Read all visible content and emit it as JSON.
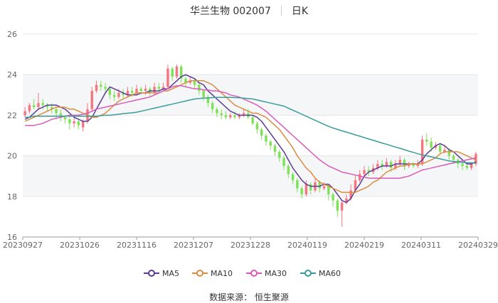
{
  "title": {
    "stock": "华兰生物 002007",
    "period": "日K"
  },
  "source_text": "数据来源：  恒生聚源",
  "chart_data": {
    "type": "candlestick",
    "ylim": [
      16,
      26
    ],
    "y_ticks": [
      16,
      18,
      20,
      22,
      24,
      26
    ],
    "x_tick_labels": [
      "20230927",
      "20231026",
      "20231116",
      "20231207",
      "20231228",
      "20240119",
      "20240219",
      "20240311",
      "20240329"
    ],
    "grid": "horizontal bands",
    "legend_position": "bottom-center",
    "colors": {
      "up": "#f4777f",
      "down": "#7fe157",
      "ma5": "#5a3b98",
      "ma10": "#dc8c40",
      "ma30": "#d95bb8",
      "ma60": "#3a9c98",
      "band": "#f5f6f8"
    },
    "candles": [
      [
        22.0,
        22.2,
        22.4,
        21.9
      ],
      [
        22.2,
        22.5,
        22.6,
        22.1
      ],
      [
        22.5,
        22.4,
        22.8,
        22.3
      ],
      [
        22.4,
        22.6,
        23.1,
        22.3
      ],
      [
        22.6,
        22.5,
        22.8,
        22.3
      ],
      [
        22.5,
        22.4,
        22.6,
        22.2
      ],
      [
        22.4,
        22.3,
        22.6,
        22.1
      ],
      [
        22.3,
        22.1,
        22.4,
        21.8
      ],
      [
        22.1,
        21.9,
        22.3,
        21.7
      ],
      [
        21.9,
        21.8,
        22.0,
        21.6
      ],
      [
        21.8,
        21.6,
        21.9,
        21.3
      ],
      [
        21.6,
        21.7,
        22.0,
        21.4
      ],
      [
        21.7,
        21.5,
        21.8,
        21.3
      ],
      [
        21.4,
        21.7,
        21.8,
        21.2
      ],
      [
        21.7,
        22.3,
        22.6,
        21.6
      ],
      [
        22.3,
        23.2,
        23.4,
        22.2
      ],
      [
        23.2,
        23.5,
        23.7,
        23.1
      ],
      [
        23.5,
        23.4,
        23.7,
        23.2
      ],
      [
        23.4,
        23.3,
        23.6,
        23.1
      ],
      [
        23.3,
        23.0,
        23.4,
        22.8
      ],
      [
        23.0,
        22.9,
        23.2,
        22.7
      ],
      [
        22.9,
        23.1,
        23.3,
        22.8
      ],
      [
        23.1,
        23.0,
        23.3,
        22.8
      ],
      [
        23.0,
        23.2,
        23.4,
        22.9
      ],
      [
        23.2,
        23.1,
        23.4,
        22.9
      ],
      [
        23.1,
        23.3,
        23.5,
        23.0
      ],
      [
        23.3,
        23.2,
        23.4,
        23.0
      ],
      [
        23.2,
        23.3,
        23.5,
        23.0
      ],
      [
        23.3,
        23.1,
        23.4,
        22.9
      ],
      [
        23.1,
        23.4,
        23.6,
        23.0
      ],
      [
        23.4,
        23.3,
        23.6,
        23.1
      ],
      [
        23.3,
        23.4,
        23.6,
        23.2
      ],
      [
        23.4,
        24.3,
        24.5,
        23.3
      ],
      [
        24.3,
        23.9,
        24.4,
        23.7
      ],
      [
        23.9,
        24.4,
        24.5,
        23.8
      ],
      [
        24.4,
        23.8,
        24.5,
        23.6
      ],
      [
        23.8,
        23.6,
        23.9,
        23.4
      ],
      [
        23.6,
        23.7,
        23.9,
        23.5
      ],
      [
        23.7,
        23.5,
        23.8,
        23.3
      ],
      [
        23.5,
        23.2,
        23.6,
        23.0
      ],
      [
        23.2,
        22.9,
        23.3,
        22.7
      ],
      [
        22.9,
        22.6,
        23.0,
        22.4
      ],
      [
        22.6,
        22.3,
        22.7,
        22.1
      ],
      [
        22.3,
        22.1,
        22.4,
        21.9
      ],
      [
        22.1,
        22.0,
        22.3,
        21.8
      ],
      [
        22.0,
        21.9,
        22.2,
        21.8
      ],
      [
        21.9,
        22.0,
        22.1,
        21.8
      ],
      [
        22.0,
        21.9,
        22.2,
        21.8
      ],
      [
        21.9,
        22.0,
        22.1,
        21.8
      ],
      [
        22.0,
        22.1,
        22.3,
        21.9
      ],
      [
        22.1,
        21.9,
        22.3,
        21.8
      ],
      [
        21.9,
        21.6,
        22.0,
        21.5
      ],
      [
        21.6,
        21.3,
        21.7,
        21.1
      ],
      [
        21.3,
        21.0,
        21.4,
        20.8
      ],
      [
        21.0,
        20.7,
        21.1,
        20.5
      ],
      [
        20.7,
        20.5,
        20.8,
        20.3
      ],
      [
        20.5,
        20.2,
        20.6,
        20.0
      ],
      [
        20.2,
        19.9,
        20.3,
        19.7
      ],
      [
        19.9,
        19.5,
        20.0,
        19.3
      ],
      [
        19.5,
        19.1,
        19.6,
        18.9
      ],
      [
        19.1,
        18.8,
        19.2,
        18.6
      ],
      [
        18.8,
        18.4,
        18.9,
        18.2
      ],
      [
        18.4,
        18.1,
        18.5,
        17.9
      ],
      [
        18.1,
        18.6,
        18.8,
        18.0
      ],
      [
        18.6,
        18.3,
        18.7,
        18.1
      ],
      [
        18.3,
        18.7,
        18.9,
        18.2
      ],
      [
        18.7,
        18.4,
        18.8,
        18.2
      ],
      [
        18.4,
        18.5,
        18.7,
        18.3
      ],
      [
        18.5,
        18.1,
        18.6,
        17.8
      ],
      [
        18.1,
        17.8,
        18.2,
        17.5
      ],
      [
        17.8,
        17.3,
        17.9,
        17.0
      ],
      [
        17.3,
        17.7,
        17.8,
        16.5
      ],
      [
        17.7,
        17.9,
        18.1,
        17.6
      ],
      [
        17.9,
        18.3,
        18.6,
        17.8
      ],
      [
        18.3,
        18.8,
        19.0,
        18.2
      ],
      [
        18.8,
        19.1,
        19.3,
        18.7
      ],
      [
        19.1,
        19.3,
        19.5,
        19.0
      ],
      [
        19.3,
        19.2,
        19.5,
        19.0
      ],
      [
        19.2,
        19.4,
        19.6,
        19.1
      ],
      [
        19.4,
        19.6,
        19.8,
        19.3
      ],
      [
        19.6,
        19.5,
        19.8,
        19.3
      ],
      [
        19.5,
        19.7,
        19.9,
        19.4
      ],
      [
        19.7,
        19.4,
        19.8,
        19.2
      ],
      [
        19.4,
        19.6,
        19.8,
        19.3
      ],
      [
        19.6,
        19.8,
        20.0,
        19.5
      ],
      [
        19.8,
        19.5,
        19.9,
        19.3
      ],
      [
        19.5,
        19.6,
        19.7,
        19.4
      ],
      [
        19.6,
        19.5,
        19.7,
        19.4
      ],
      [
        19.5,
        19.6,
        19.8,
        19.4
      ],
      [
        19.6,
        20.8,
        21.0,
        19.5
      ],
      [
        20.8,
        20.7,
        21.1,
        20.5
      ],
      [
        20.7,
        20.4,
        20.9,
        20.2
      ],
      [
        20.4,
        20.5,
        20.7,
        20.3
      ],
      [
        20.5,
        20.2,
        20.6,
        20.1
      ],
      [
        20.2,
        20.3,
        20.5,
        20.1
      ],
      [
        20.3,
        20.0,
        20.4,
        19.8
      ],
      [
        20.0,
        19.8,
        20.1,
        19.6
      ],
      [
        19.8,
        19.6,
        19.9,
        19.4
      ],
      [
        19.6,
        19.5,
        19.7,
        19.3
      ],
      [
        19.5,
        19.4,
        19.6,
        19.3
      ],
      [
        19.4,
        19.6,
        19.7,
        19.3
      ],
      [
        19.6,
        20.1,
        20.2,
        19.5
      ]
    ],
    "series": [
      {
        "name": "MA5",
        "values": [
          21.8,
          21.9,
          22.1,
          22.3,
          22.4,
          22.5,
          22.5,
          22.5,
          22.4,
          22.3,
          22.1,
          21.9,
          21.8,
          21.7,
          21.7,
          21.9,
          22.3,
          22.7,
          23.1,
          23.4,
          23.3,
          23.2,
          23.1,
          23.0,
          23.0,
          23.0,
          23.1,
          23.1,
          23.2,
          23.2,
          23.2,
          23.3,
          23.3,
          23.5,
          23.7,
          23.9,
          24.0,
          23.9,
          23.8,
          23.6,
          23.5,
          23.2,
          23.0,
          22.8,
          22.6,
          22.4,
          22.2,
          22.1,
          22.0,
          22.0,
          22.0,
          22.0,
          21.9,
          21.7,
          21.4,
          21.1,
          20.8,
          20.5,
          20.2,
          19.8,
          19.4,
          19.1,
          18.8,
          18.6,
          18.5,
          18.5,
          18.5,
          18.6,
          18.6,
          18.4,
          18.1,
          17.8,
          17.7,
          17.9,
          18.3,
          18.6,
          19.0,
          19.2,
          19.3,
          19.4,
          19.5,
          19.5,
          19.5,
          19.6,
          19.6,
          19.6,
          19.6,
          19.6,
          19.6,
          19.8,
          20.1,
          20.3,
          20.5,
          20.6,
          20.5,
          20.3,
          20.2,
          20.0,
          19.8,
          19.6,
          19.6,
          19.7
        ]
      },
      {
        "name": "MA10",
        "values": [
          21.7,
          21.8,
          21.9,
          22.0,
          22.1,
          22.2,
          22.3,
          22.4,
          22.4,
          22.4,
          22.3,
          22.3,
          22.2,
          22.1,
          22.0,
          21.9,
          21.9,
          22.0,
          22.1,
          22.3,
          22.5,
          22.7,
          22.8,
          22.9,
          23.0,
          23.1,
          23.1,
          23.1,
          23.1,
          23.1,
          23.1,
          23.2,
          23.2,
          23.3,
          23.4,
          23.5,
          23.6,
          23.7,
          23.7,
          23.7,
          23.7,
          23.6,
          23.5,
          23.3,
          23.1,
          22.9,
          22.7,
          22.5,
          22.4,
          22.3,
          22.2,
          22.1,
          22.1,
          22.0,
          21.9,
          21.7,
          21.5,
          21.3,
          21.0,
          20.7,
          20.4,
          20.0,
          19.7,
          19.4,
          19.2,
          18.9,
          18.7,
          18.6,
          18.5,
          18.4,
          18.3,
          18.2,
          18.2,
          18.2,
          18.2,
          18.3,
          18.4,
          18.5,
          18.7,
          18.8,
          19.0,
          19.2,
          19.3,
          19.4,
          19.5,
          19.5,
          19.6,
          19.6,
          19.6,
          19.6,
          19.7,
          19.8,
          19.9,
          20.1,
          20.2,
          20.2,
          20.2,
          20.2,
          20.1,
          20.0,
          19.9,
          19.8
        ]
      },
      {
        "name": "MA30",
        "values": [
          21.5,
          21.5,
          21.5,
          21.55,
          21.6,
          21.7,
          21.8,
          21.85,
          21.9,
          21.95,
          22.0,
          22.0,
          22.0,
          22.05,
          22.1,
          22.2,
          22.3,
          22.35,
          22.4,
          22.45,
          22.5,
          22.55,
          22.6,
          22.65,
          22.7,
          22.75,
          22.8,
          22.85,
          22.9,
          23.0,
          23.1,
          23.2,
          23.3,
          23.4,
          23.45,
          23.45,
          23.4,
          23.35,
          23.3,
          23.3,
          23.25,
          23.25,
          23.2,
          23.2,
          23.15,
          23.1,
          23.0,
          22.95,
          22.9,
          22.8,
          22.7,
          22.6,
          22.5,
          22.35,
          22.2,
          22.0,
          21.8,
          21.6,
          21.4,
          21.2,
          21.0,
          20.8,
          20.6,
          20.4,
          20.2,
          20.0,
          19.8,
          19.65,
          19.5,
          19.4,
          19.3,
          19.2,
          19.15,
          19.1,
          19.05,
          19.0,
          18.95,
          18.9,
          18.9,
          18.9,
          18.9,
          18.9,
          18.9,
          18.9,
          18.9,
          18.95,
          19.0,
          19.1,
          19.2,
          19.3,
          19.35,
          19.4,
          19.45,
          19.5,
          19.55,
          19.6,
          19.65,
          19.7,
          19.75,
          19.8,
          19.85,
          19.9
        ]
      },
      {
        "name": "MA60",
        "values": [
          21.9,
          21.9,
          21.95,
          21.95,
          21.95,
          21.95,
          21.95,
          21.95,
          21.95,
          21.95,
          21.95,
          21.95,
          21.95,
          21.95,
          21.95,
          21.95,
          21.95,
          21.98,
          22.0,
          22.0,
          22.02,
          22.05,
          22.08,
          22.1,
          22.12,
          22.15,
          22.2,
          22.25,
          22.3,
          22.35,
          22.4,
          22.45,
          22.5,
          22.55,
          22.6,
          22.65,
          22.7,
          22.75,
          22.8,
          22.82,
          22.85,
          22.85,
          22.87,
          22.88,
          22.88,
          22.88,
          22.88,
          22.87,
          22.86,
          22.84,
          22.82,
          22.8,
          22.75,
          22.7,
          22.65,
          22.6,
          22.55,
          22.5,
          22.45,
          22.35,
          22.25,
          22.15,
          22.05,
          21.95,
          21.85,
          21.75,
          21.65,
          21.55,
          21.45,
          21.37,
          21.3,
          21.23,
          21.17,
          21.1,
          21.03,
          20.97,
          20.9,
          20.83,
          20.77,
          20.7,
          20.63,
          20.57,
          20.5,
          20.43,
          20.37,
          20.3,
          20.23,
          20.17,
          20.1,
          20.05,
          20.0,
          19.95,
          19.9,
          19.85,
          19.8,
          19.75,
          19.72,
          19.7,
          19.68,
          19.66,
          19.65,
          19.64
        ]
      }
    ]
  }
}
